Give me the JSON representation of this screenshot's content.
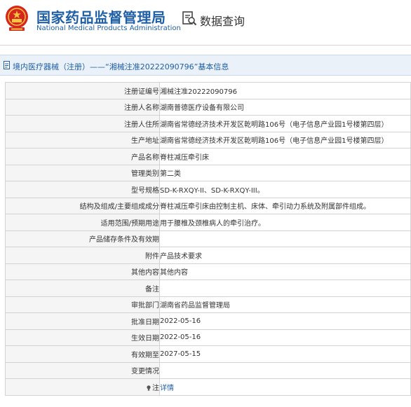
{
  "header": {
    "title_cn": "国家药品监督管理局",
    "title_en": "National Medical Products Administration",
    "query_title": "数据查询",
    "brand_color": "#1f5fa6",
    "emblem_color": "#d7261e",
    "emblem_icon": "national-emblem",
    "query_icon": "document-search-icon"
  },
  "breadcrumb": {
    "icon": "document-icon",
    "text": "境内医疗器械（注册）——“湘械注准20222090796”基本信息"
  },
  "rows": [
    {
      "label": "注册证编号",
      "value": "湘械注准20222090796"
    },
    {
      "label": "注册人名称",
      "value": "湖南普德医疗设备有限公司"
    },
    {
      "label": "注册人住所",
      "value": "湖南省常德经济技术开发区乾明路106号（电子信息产业园1号楼第四层）"
    },
    {
      "label": "生产地址",
      "value": "湖南省常德经济技术开发区乾明路106号（电子信息产业园1号楼第四层）"
    },
    {
      "label": "产品名称",
      "value": "脊柱减压牵引床"
    },
    {
      "label": "管理类别",
      "value": "第二类"
    },
    {
      "label": "型号规格",
      "value": "SD-K-RXQY-II、SD-K-RXQY-III。"
    },
    {
      "label": "结构及组成/主要组成成分",
      "value": "脊柱减压牵引床由控制主机、床体、牵引动力系统及附属部件组成。"
    },
    {
      "label": "适用范围/预期用途",
      "value": "用于腰椎及颈椎病人的牵引治疗。"
    },
    {
      "label": "产品储存条件及有效期",
      "value": ""
    },
    {
      "label": "附件",
      "value": "产品技术要求"
    },
    {
      "label": "其他内容",
      "value": "其他内容"
    },
    {
      "label": "备注",
      "value": ""
    },
    {
      "label": "审批部门",
      "value": "湖南省药品监督管理局"
    },
    {
      "label": "批准日期",
      "value": "2022-05-16"
    },
    {
      "label": "生效日期",
      "value": "2022-05-16"
    },
    {
      "label": "有效期至",
      "value": "2027-05-15"
    },
    {
      "label": "变更情况",
      "value": ""
    }
  ],
  "note_row": {
    "label": "注",
    "icon": "lightbulb-icon",
    "link": "详情"
  }
}
